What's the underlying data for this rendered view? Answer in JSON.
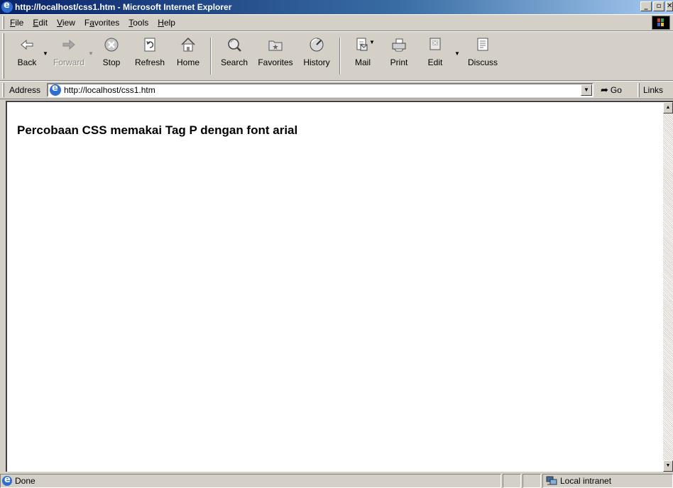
{
  "window": {
    "title": "http://localhost/css1.htm - Microsoft Internet Explorer",
    "buttons": {
      "minimize": "_",
      "maximize": "▫",
      "close": "✕"
    }
  },
  "menu": {
    "items": [
      {
        "label": "File",
        "accel": "F",
        "rest": "ile"
      },
      {
        "label": "Edit",
        "accel": "E",
        "rest": "dit"
      },
      {
        "label": "View",
        "accel": "V",
        "rest": "iew"
      },
      {
        "label": "Favorites",
        "accel": "a",
        "pre": "F",
        "rest": "vorites"
      },
      {
        "label": "Tools",
        "accel": "T",
        "rest": "ools"
      },
      {
        "label": "Help",
        "accel": "H",
        "rest": "elp"
      }
    ]
  },
  "toolbar": {
    "back": "Back",
    "forward": "Forward",
    "stop": "Stop",
    "refresh": "Refresh",
    "home": "Home",
    "search": "Search",
    "favorites": "Favorites",
    "history": "History",
    "mail": "Mail",
    "print": "Print",
    "edit": "Edit",
    "discuss": "Discuss"
  },
  "address_bar": {
    "label": "Address",
    "url": "http://localhost/css1.htm",
    "go": "Go",
    "links": "Links"
  },
  "page": {
    "heading": "Percobaan CSS memakai Tag P dengan font arial"
  },
  "status_bar": {
    "text": "Done",
    "zone": "Local intranet"
  }
}
